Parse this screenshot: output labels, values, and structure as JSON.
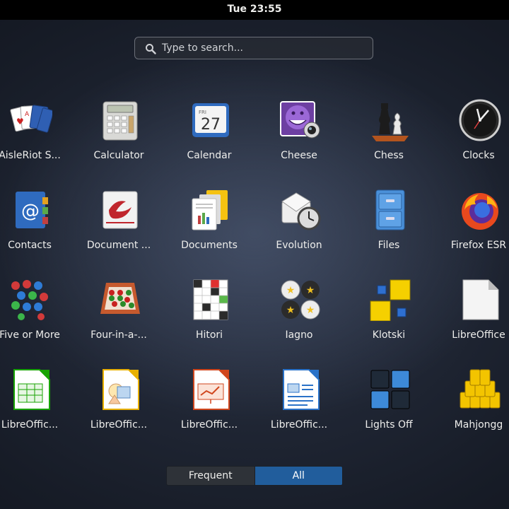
{
  "topbar": {
    "clock": "Tue 23:55"
  },
  "search": {
    "placeholder": "Type to search..."
  },
  "apps": [
    {
      "label": "AisleRiot S...",
      "icon": "aisleriot-icon"
    },
    {
      "label": "Calculator",
      "icon": "calculator-icon"
    },
    {
      "label": "Calendar",
      "icon": "calendar-icon",
      "glyph_top": "FRI",
      "glyph_day": "27"
    },
    {
      "label": "Cheese",
      "icon": "cheese-icon"
    },
    {
      "label": "Chess",
      "icon": "chess-icon"
    },
    {
      "label": "Clocks",
      "icon": "clocks-icon"
    },
    {
      "label": "Contacts",
      "icon": "contacts-icon"
    },
    {
      "label": "Document ...",
      "icon": "document-viewer-icon"
    },
    {
      "label": "Documents",
      "icon": "documents-icon"
    },
    {
      "label": "Evolution",
      "icon": "evolution-icon"
    },
    {
      "label": "Files",
      "icon": "files-icon"
    },
    {
      "label": "Firefox ESR",
      "icon": "firefox-icon"
    },
    {
      "label": "Five or More",
      "icon": "five-or-more-icon"
    },
    {
      "label": "Four-in-a-...",
      "icon": "four-in-a-row-icon"
    },
    {
      "label": "Hitori",
      "icon": "hitori-icon"
    },
    {
      "label": "Iagno",
      "icon": "iagno-icon"
    },
    {
      "label": "Klotski",
      "icon": "klotski-icon"
    },
    {
      "label": "LibreOffice",
      "icon": "libreoffice-icon"
    },
    {
      "label": "LibreOffic...",
      "icon": "libreoffice-calc-icon"
    },
    {
      "label": "LibreOffic...",
      "icon": "libreoffice-draw-icon"
    },
    {
      "label": "LibreOffic...",
      "icon": "libreoffice-impress-icon"
    },
    {
      "label": "LibreOffic...",
      "icon": "libreoffice-writer-icon"
    },
    {
      "label": "Lights Off",
      "icon": "lights-off-icon"
    },
    {
      "label": "Mahjongg",
      "icon": "mahjongg-icon"
    }
  ],
  "view_switch": {
    "frequent": "Frequent",
    "all": "All",
    "active": "all"
  },
  "colors": {
    "accent": "#215d9c",
    "topbar": "#000000"
  }
}
